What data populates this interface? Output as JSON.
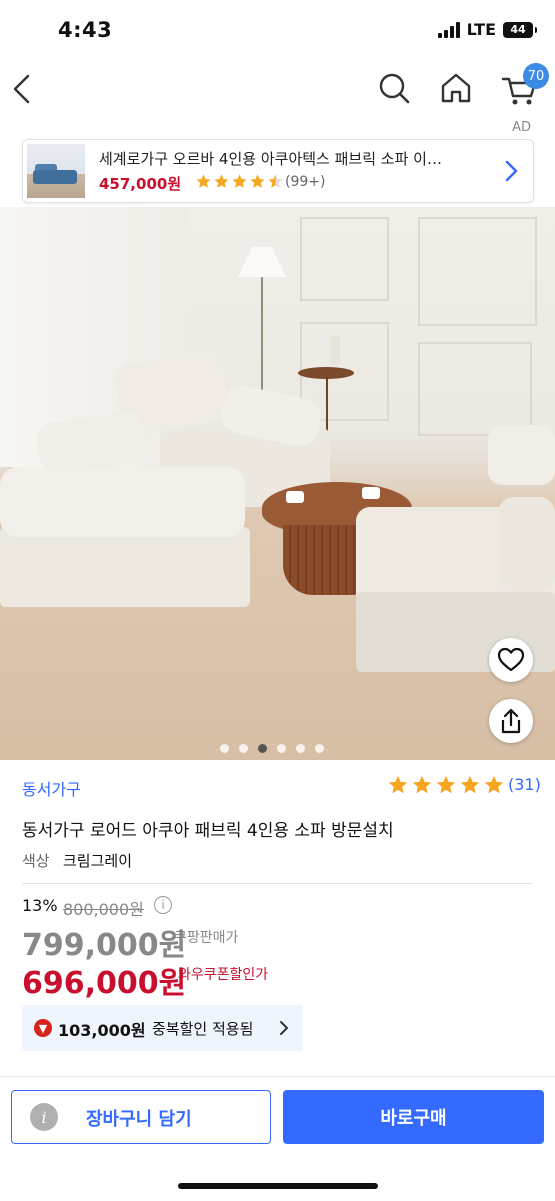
{
  "status_bar": {
    "time": "4:43",
    "network": "LTE",
    "battery": "44"
  },
  "nav": {
    "cart_count": "70"
  },
  "ad": {
    "label": "AD",
    "title": "세계로가구 오르바 4인용 아쿠아텍스 패브릭 소파 이…",
    "price": "457,000원",
    "rating": 4.5,
    "reviews": "(99+)"
  },
  "gallery": {
    "image_count": 6,
    "current_index": 3
  },
  "product": {
    "brand": "동서가구",
    "rating": 5,
    "rating_count": "(31)",
    "title": "동서가구 로어드 아쿠아 패브릭 4인용 소파 방문설치",
    "color_label": "색상",
    "color_value": "크림그레이",
    "discount_rate": "13%",
    "original_price": "800,000원",
    "sale_price": "799,000원",
    "sale_price_label": "쿠팡판매가",
    "coupon_price": "696,000원",
    "coupon_price_label": "와우쿠폰할인가",
    "extra_discount_amount": "103,000원",
    "extra_discount_text": "중복할인 적용됨"
  },
  "actions": {
    "add_to_cart": "장바구니 담기",
    "buy_now": "바로구매"
  },
  "colors": {
    "accent": "#346aff",
    "price_red": "#c8102e",
    "badge_blue": "#3c8ce7"
  }
}
